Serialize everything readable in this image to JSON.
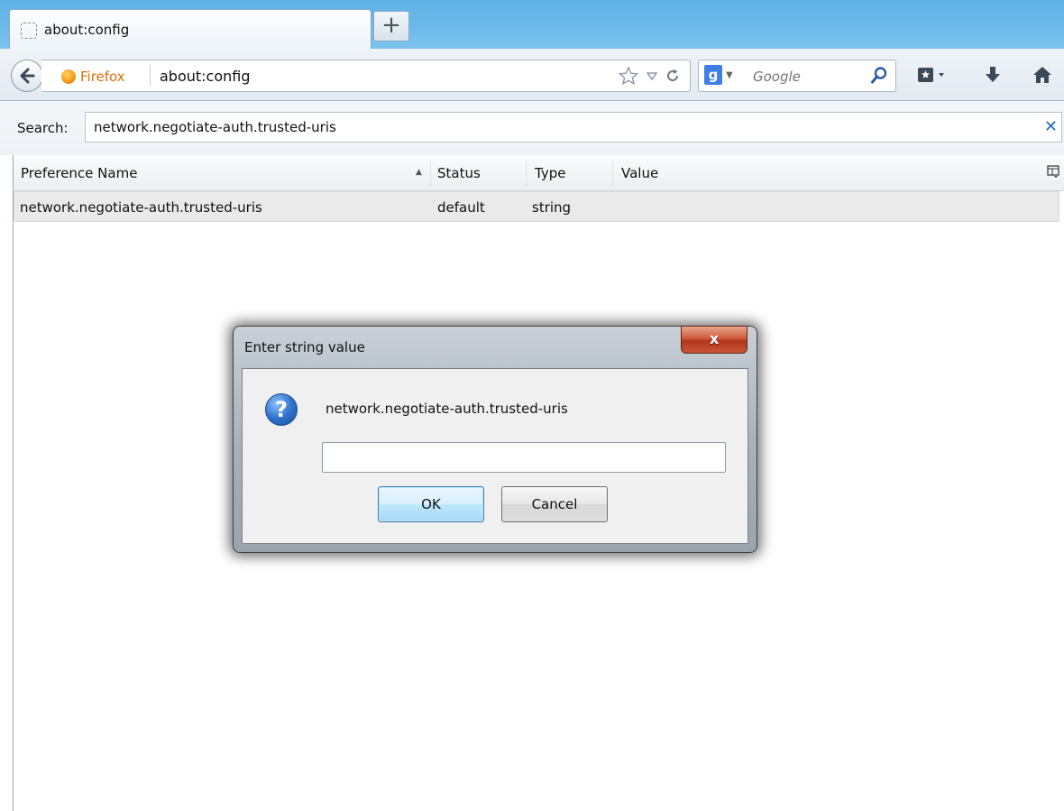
{
  "tab": {
    "title": "about:config",
    "new_tab_label": "+"
  },
  "navbar": {
    "identity_label": "Firefox",
    "url": "about:config",
    "search_engine": "Google",
    "search_placeholder": "Google"
  },
  "config": {
    "search_label": "Search:",
    "search_value": "network.negotiate-auth.trusted-uris",
    "clear_label": "✕",
    "columns": {
      "name": "Preference Name",
      "status": "Status",
      "type": "Type",
      "value": "Value"
    },
    "rows": [
      {
        "name": "network.negotiate-auth.trusted-uris",
        "status": "default",
        "type": "string",
        "value": ""
      }
    ]
  },
  "dialog": {
    "title": "Enter string value",
    "close_label": "x",
    "message": "network.negotiate-auth.trusted-uris",
    "input_value": "",
    "ok_label": "OK",
    "cancel_label": "Cancel"
  },
  "colors": {
    "tabstrip": "#69b8ea",
    "identity": "#d9700b",
    "close_button": "#c9573a",
    "ok_border": "#3c7fb1"
  }
}
